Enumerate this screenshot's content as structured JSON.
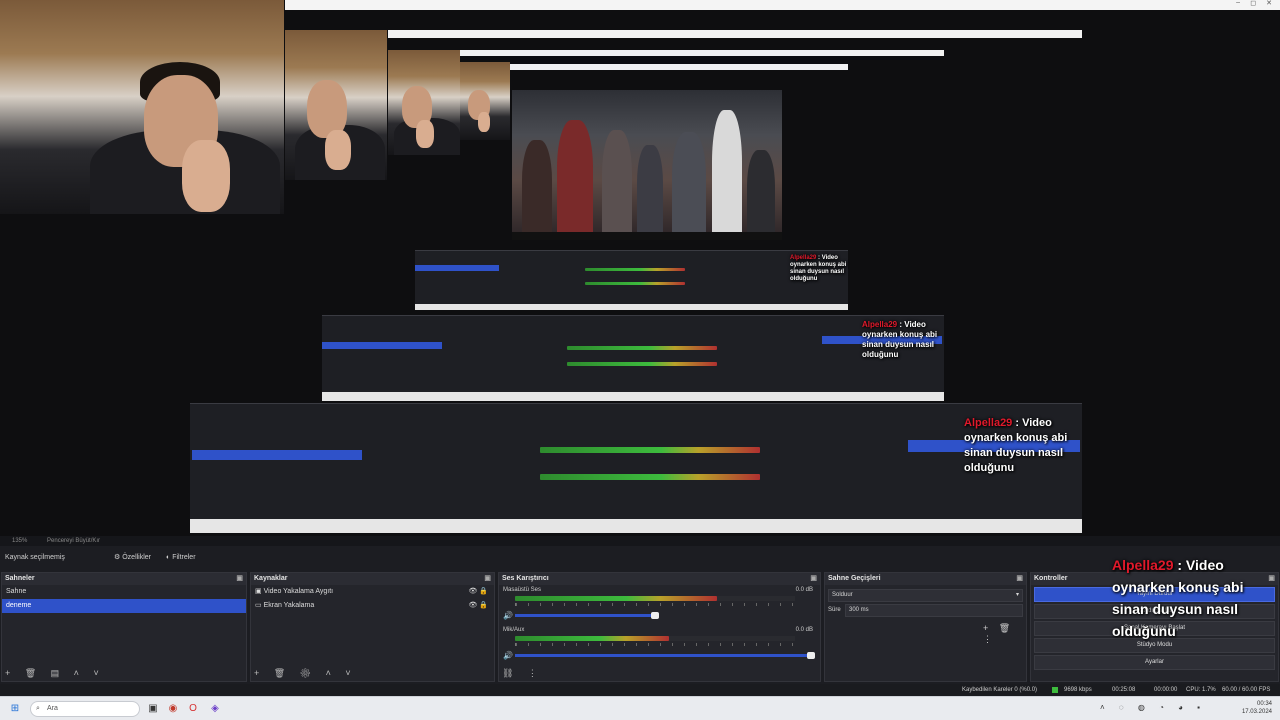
{
  "titlebar": {
    "min_icon": "–",
    "max_icon": "◻",
    "close_icon": "✕"
  },
  "chat": {
    "username": "Alpella29",
    "separator": " : Video",
    "lines": [
      "oynarken konuş abi",
      "sinan duysun nasıl",
      "olduğunu"
    ]
  },
  "obs": {
    "topbar_items": [
      "135%",
      "Pencereyi Büyüt/Kır"
    ],
    "source_selected": "Kaynak seçilmemiş",
    "properties_label": "Özellikler",
    "filters_label": "Filtreler",
    "scenes": {
      "title": "Sahneler",
      "items": [
        "Sahne",
        "deneme"
      ],
      "selected": 1
    },
    "sources": {
      "title": "Kaynaklar",
      "items": [
        "Video Yakalama Aygıtı",
        "Ekran Yakalama"
      ]
    },
    "mixer": {
      "title": "Ses Karıştırıcı",
      "tracks": [
        {
          "name": "Masaüstü Ses",
          "db": "0.0 dB",
          "level": 0.72
        },
        {
          "name": "Mik/Aux",
          "db": "0.0 dB",
          "level": 0.55
        }
      ],
      "tick_labels": [
        "-60",
        "-55",
        "-50",
        "-45",
        "-40",
        "-35",
        "-30",
        "-25",
        "-20",
        "-15",
        "-10",
        "-5",
        "0"
      ]
    },
    "transitions": {
      "title": "Sahne Geçişleri",
      "type": "Solduur",
      "duration_label": "Süre",
      "duration": "300 ms"
    },
    "controls": {
      "title": "Kontroller",
      "buttons": [
        "Yayını Durdur",
        "Kaydı Başlat",
        "Sanal Kamerayı Başlat",
        "Stüdyo Modu",
        "Ayarlar"
      ]
    },
    "status": {
      "dropped": "Kaybedilen Kareler 0 (%0.0)",
      "bitrate": "9698 kbps",
      "stream_time": "00:25:08",
      "record_time": "00:00:00",
      "cpu": "CPU: 1.7%",
      "fps": "60.00 / 60.00 FPS"
    }
  },
  "taskbar": {
    "search_placeholder": "Ara",
    "time": "00:34",
    "date": "17.03.2024"
  },
  "colors": {
    "accent": "#2f52c9",
    "chat_name": "#e0192b",
    "meter_green": "#3dbb3d"
  }
}
